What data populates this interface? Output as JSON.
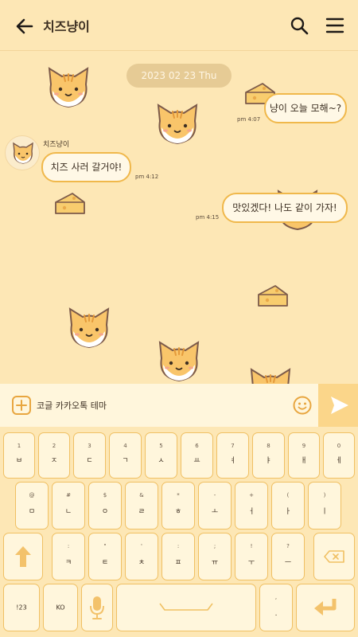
{
  "header": {
    "title": "치즈냥이"
  },
  "chat": {
    "date": "2023 02 23 Thu",
    "messages": [
      {
        "side": "right",
        "text": "냥이 오늘 모해~?",
        "time": "pm 4:07"
      },
      {
        "side": "left",
        "sender": "치즈냥이",
        "text": "치즈 사러 갈거야!",
        "time": "pm 4:12"
      },
      {
        "side": "right",
        "text": "맛있겠다! 나도 같이 가자!",
        "time": "pm 4:15"
      }
    ]
  },
  "input": {
    "value": "코글 카카오톡 테마"
  },
  "keyboard": {
    "row1": [
      {
        "hint": "1",
        "main": "ㅂ"
      },
      {
        "hint": "2",
        "main": "ㅈ"
      },
      {
        "hint": "3",
        "main": "ㄷ"
      },
      {
        "hint": "4",
        "main": "ㄱ"
      },
      {
        "hint": "5",
        "main": "ㅅ"
      },
      {
        "hint": "6",
        "main": "ㅛ"
      },
      {
        "hint": "7",
        "main": "ㅕ"
      },
      {
        "hint": "8",
        "main": "ㅑ"
      },
      {
        "hint": "9",
        "main": "ㅐ"
      },
      {
        "hint": "0",
        "main": "ㅔ"
      }
    ],
    "row2": [
      {
        "hint": "@",
        "main": "ㅁ"
      },
      {
        "hint": "#",
        "main": "ㄴ"
      },
      {
        "hint": "$",
        "main": "ㅇ"
      },
      {
        "hint": "&",
        "main": "ㄹ"
      },
      {
        "hint": "*",
        "main": "ㅎ"
      },
      {
        "hint": "-",
        "main": "ㅗ"
      },
      {
        "hint": "+",
        "main": "ㅓ"
      },
      {
        "hint": "(",
        "main": "ㅏ"
      },
      {
        "hint": ")",
        "main": "ㅣ"
      }
    ],
    "row3": [
      {
        "hint": ":",
        "main": "ㅋ"
      },
      {
        "hint": "\"",
        "main": "ㅌ"
      },
      {
        "hint": "'",
        "main": "ㅊ"
      },
      {
        "hint": ":",
        "main": "ㅍ"
      },
      {
        "hint": ";",
        "main": "ㅠ"
      },
      {
        "hint": "!",
        "main": "ㅜ"
      },
      {
        "hint": "?",
        "main": "ㅡ"
      }
    ],
    "numbers_label": "!23",
    "language_label": "KO",
    "period_hint": ",",
    "period_label": "."
  },
  "colors": {
    "background": "#fde7b5",
    "bubble_border": "#f0b84b",
    "bubble_fill": "#fff8e6",
    "key_fill": "#fff6dc",
    "key_border": "#f0c063",
    "send_fill": "#fbd68a"
  },
  "icons": {
    "back": "arrow-left-icon",
    "search": "search-icon",
    "menu": "hamburger-menu-icon",
    "plus": "plus-icon",
    "emoji": "emoji-smile-icon",
    "send": "send-triangle-icon",
    "shift": "shift-arrow-icon",
    "backspace": "backspace-icon",
    "mic": "microphone-icon",
    "enter": "enter-arrow-icon"
  }
}
